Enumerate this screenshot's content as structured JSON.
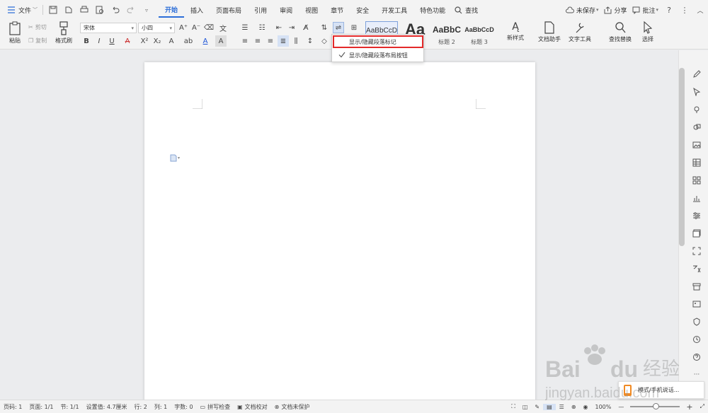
{
  "menubar": {
    "file_label": "文件",
    "tabs": [
      "开始",
      "插入",
      "页面布局",
      "引用",
      "审阅",
      "视图",
      "章节",
      "安全",
      "开发工具",
      "特色功能"
    ],
    "active_tab": "开始",
    "search_label": "查找",
    "unsaved_label": "未保存",
    "share_label": "分享",
    "comment_label": "批注"
  },
  "ribbon": {
    "paste_label": "粘贴",
    "cut_label": "剪切",
    "copy_label": "复制",
    "format_painter_label": "格式刷",
    "font_name": "宋体",
    "font_size": "小四",
    "styles": [
      {
        "preview": "AaBbCcD",
        "label": ""
      },
      {
        "preview": "Aa",
        "label": ""
      },
      {
        "preview": "AaBbC",
        "label": "标题 2"
      },
      {
        "preview": "AaBbCcD",
        "label": "标题 3"
      }
    ],
    "new_style_label": "新样式",
    "doc_assistant_label": "文档助手",
    "text_tools_label": "文字工具",
    "find_replace_label": "查找替换",
    "select_label": "选择"
  },
  "dropdown": {
    "items": [
      "显示/隐藏段落标记",
      "显示/隐藏段落布局按钮"
    ]
  },
  "statusbar": {
    "page_num": "页码: 1",
    "page": "页面: 1/1",
    "section": "节: 1/1",
    "position": "设置值: 4.7厘米",
    "row": "行: 2",
    "col": "列: 1",
    "word_count": "字数: 0",
    "spell_check": "拼写检查",
    "proofread": "文档校对",
    "unprotected": "文档未保护",
    "zoom": "100%"
  },
  "toast": {
    "text": "模式/手机说话..."
  },
  "colors": {
    "accent": "#2d6ed8",
    "highlight_box": "#e32a2a"
  }
}
